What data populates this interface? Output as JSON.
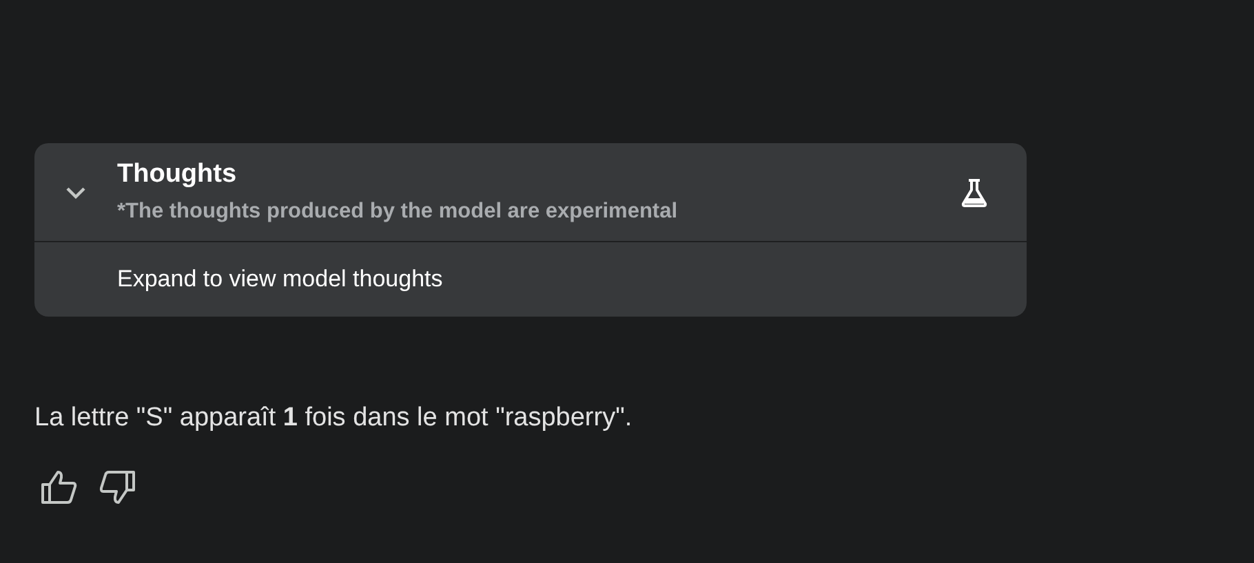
{
  "thoughts_panel": {
    "title": "Thoughts",
    "subtitle": "*The thoughts produced by the model are experimental",
    "expanded": false,
    "expand_label": "Expand to view model thoughts"
  },
  "response": {
    "text": "La lettre \"S\" apparaît **1** fois dans le mot \"raspberry\"."
  }
}
